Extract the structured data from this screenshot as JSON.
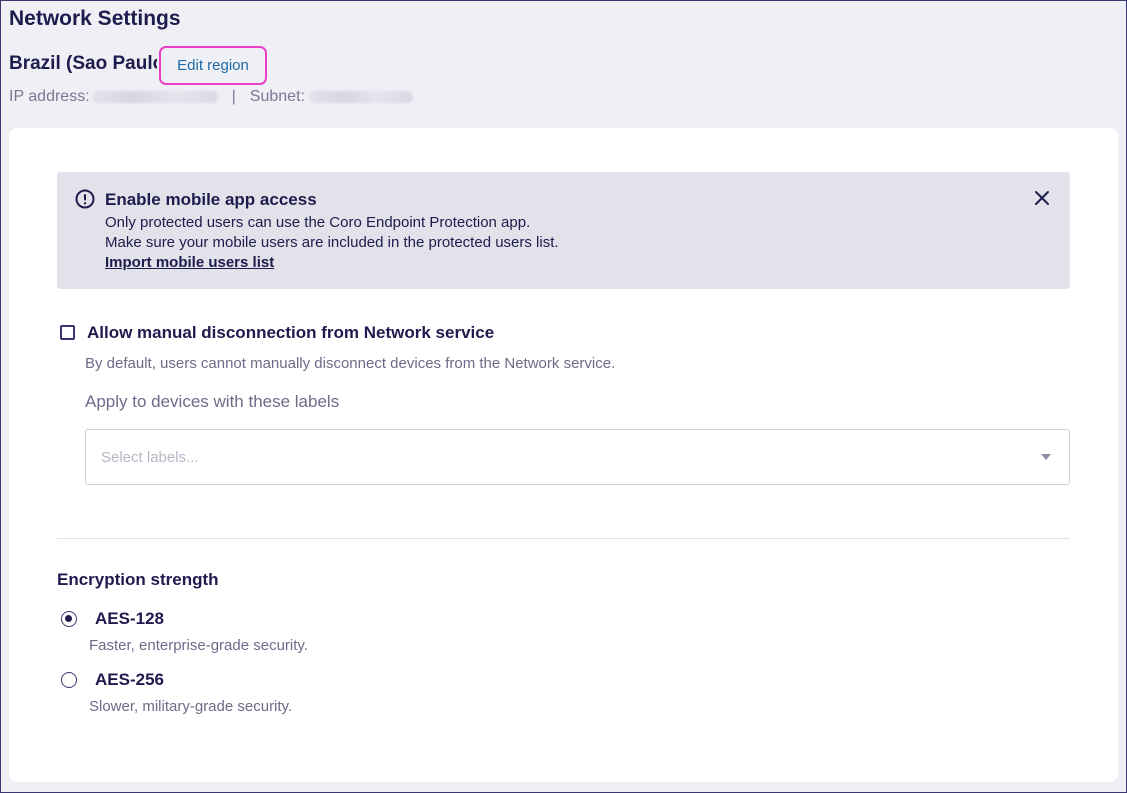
{
  "header": {
    "title": "Network Settings",
    "region_name": "Brazil (Sao Paulo)",
    "edit_region_label": "Edit region",
    "ip_label": "IP address:",
    "separator": "|",
    "subnet_label": "Subnet:"
  },
  "banner": {
    "title": "Enable mobile app access",
    "line1": "Only protected users can use the Coro Endpoint Protection app.",
    "line2": "Make sure your mobile users are included in the protected users list.",
    "link": "Import mobile users list",
    "icon": "alert-circle-icon",
    "close_icon": "close-icon"
  },
  "manual_disconnect": {
    "label": "Allow manual disconnection from Network service",
    "checked": false,
    "description": "By default, users cannot manually disconnect devices from the Network service.",
    "apply_label": "Apply to devices with these labels",
    "select_placeholder": "Select labels..."
  },
  "encryption": {
    "title": "Encryption strength",
    "options": [
      {
        "label": "AES-128",
        "description": "Faster, enterprise-grade security.",
        "selected": true
      },
      {
        "label": "AES-256",
        "description": "Slower, military-grade security.",
        "selected": false
      }
    ]
  },
  "colors": {
    "primary_text": "#1f1b4d",
    "link": "#1f6aa6",
    "highlight": "#ea3fc7",
    "banner_bg": "#e2e2ea"
  }
}
